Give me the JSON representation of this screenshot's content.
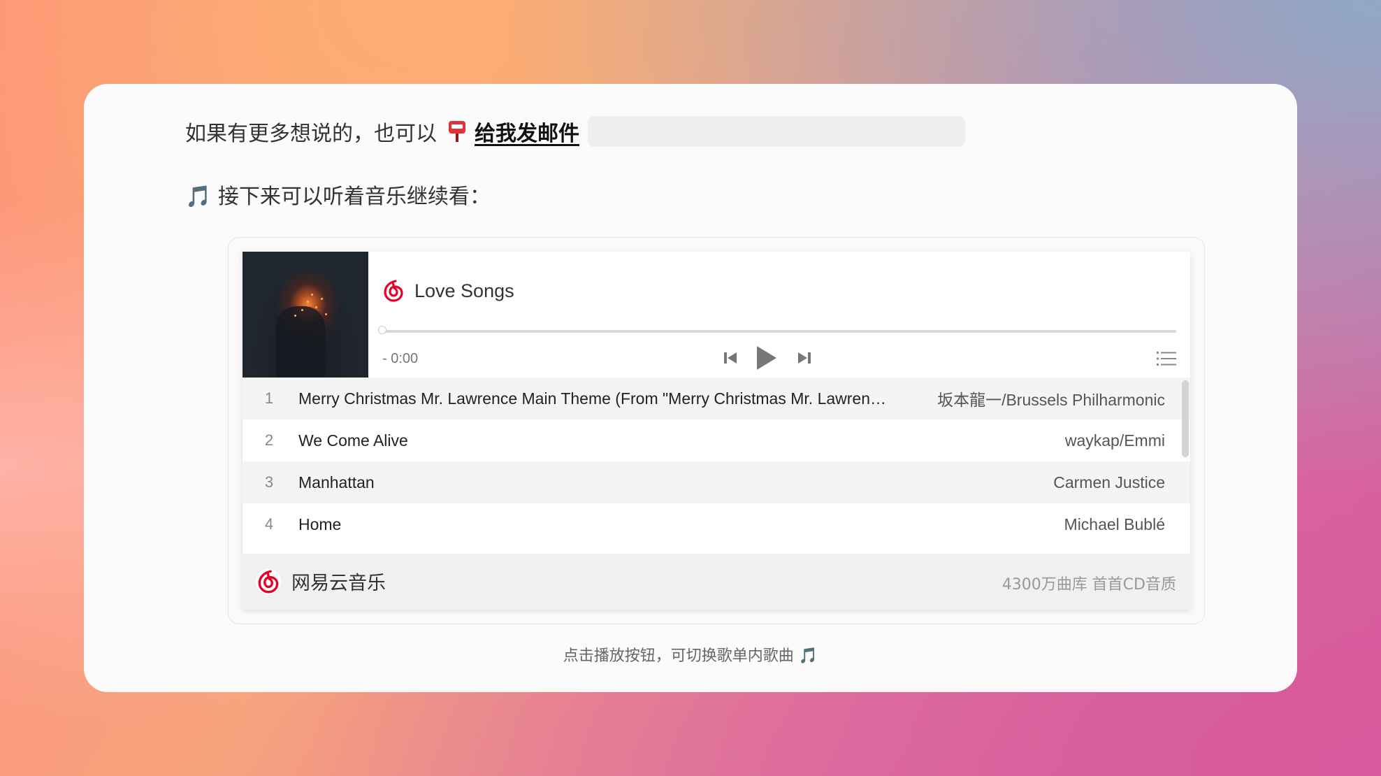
{
  "intro": {
    "text": "如果有更多想说的，也可以",
    "mailbox_icon": "postbox-icon",
    "mail_link_label": "给我发邮件"
  },
  "music_intro": {
    "icon": "music-note-icon",
    "text": "🎵 接下来可以听着音乐继续看："
  },
  "player": {
    "title": "Love Songs",
    "time": "- 0:00",
    "progress": 0,
    "brand_color": "#c20c0c",
    "tracks": [
      {
        "num": "1",
        "song": "Merry Christmas Mr. Lawrence Main Theme (From \"Merry Christmas Mr. Lawrence\")",
        "artist": "坂本龍一/Brussels Philharmonic"
      },
      {
        "num": "2",
        "song": "We Come Alive",
        "artist": "waykap/Emmi"
      },
      {
        "num": "3",
        "song": "Manhattan",
        "artist": "Carmen Justice"
      },
      {
        "num": "4",
        "song": "Home",
        "artist": "Michael Bublé"
      }
    ],
    "footer": {
      "brand": "网易云音乐",
      "slogan": "4300万曲库 首首CD音质"
    }
  },
  "caption": "点击播放按钮，可切换歌单内歌曲 🎵"
}
